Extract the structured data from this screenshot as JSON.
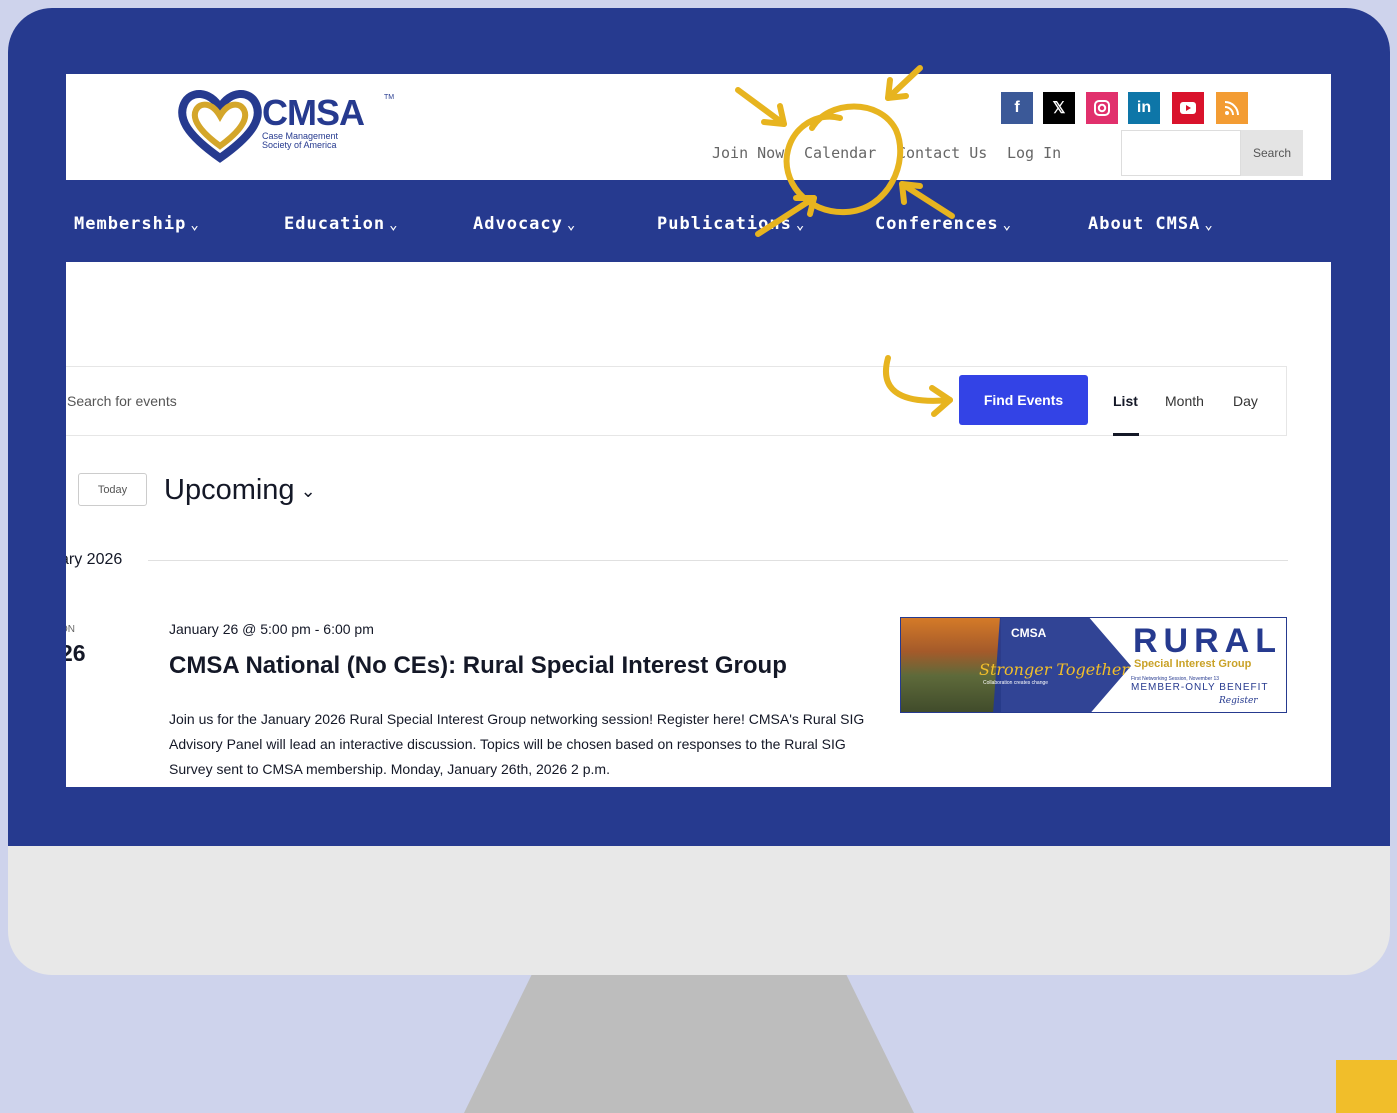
{
  "site": {
    "logo_text": "CMSA",
    "logo_tm": "TM",
    "logo_sub_line1": "Case Management",
    "logo_sub_line2": "Society of America"
  },
  "social_icons": [
    "facebook-icon",
    "x-icon",
    "instagram-icon",
    "linkedin-icon",
    "youtube-icon",
    "rss-icon"
  ],
  "top_links": {
    "join_now": "Join Now",
    "calendar": "Calendar",
    "contact_us": "Contact Us",
    "log_in": "Log In"
  },
  "search": {
    "button": "Search",
    "placeholder": ""
  },
  "nav": {
    "membership": "Membership",
    "education": "Education",
    "advocacy": "Advocacy",
    "publications": "Publications",
    "conferences": "Conferences",
    "about": "About CMSA",
    "chevron": "⌄"
  },
  "events_bar": {
    "search_placeholder": "Search for events",
    "find_button": "Find Events",
    "tabs": {
      "list": "List",
      "month": "Month",
      "day": "Day"
    },
    "active_tab": "List"
  },
  "controls": {
    "today": "Today",
    "upcoming": "Upcoming",
    "chevron": "⌄"
  },
  "month_separator": "ary 2026",
  "event": {
    "day_of_week": "ON",
    "day_number": "26",
    "time": "January 26 @ 5:00 pm - 6:00 pm",
    "title": "CMSA National (No CEs): Rural Special Interest Group",
    "description": "Join us for the January 2026 Rural Special Interest Group networking session! Register here! CMSA's Rural SIG Advisory Panel will lead an interactive discussion. Topics will be chosen based on responses to the Rural SIG Survey sent to CMSA membership. Monday, January 26th, 2026 2 p.m.",
    "image": {
      "cmsa": "CMSA",
      "script": "Stronger Together",
      "tagline": "Collaboration creates change",
      "rural": "RURAL",
      "sig": "Special Interest Group",
      "first_session": "First Networking Session, November 13",
      "benefit": "MEMBER-ONLY BENEFIT",
      "register": "Register"
    }
  },
  "colors": {
    "brand_blue": "#263a8f",
    "accent_gold": "#f1be2a",
    "find_button_blue": "#3343e6",
    "backdrop": "#ced3ec"
  }
}
